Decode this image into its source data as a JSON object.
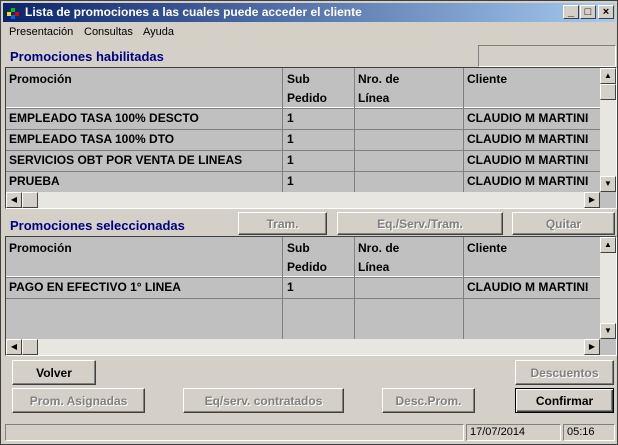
{
  "window": {
    "title": "Lista de promociones a las cuales puede acceder el cliente",
    "controls": {
      "minimize": "_",
      "maximize": "□",
      "close": "×"
    }
  },
  "menu": [
    "Presentación",
    "Consultas",
    "Ayuda"
  ],
  "habilitadas": {
    "label": "Promociones habilitadas",
    "headers": [
      "Promoción",
      "Sub\nPedido",
      "Nro. de\nLínea",
      "Cliente"
    ],
    "rows": [
      [
        "EMPLEADO TASA 100% DESCTO",
        "1",
        "",
        "CLAUDIO M MARTINI"
      ],
      [
        "EMPLEADO TASA 100% DTO",
        "1",
        "",
        "CLAUDIO M MARTINI"
      ],
      [
        "SERVICIOS OBT POR VENTA DE LINEAS",
        "1",
        "",
        "CLAUDIO M MARTINI"
      ],
      [
        "PRUEBA",
        "1",
        "",
        "CLAUDIO M MARTINI"
      ]
    ]
  },
  "seleccionadas": {
    "label": "Promociones seleccionadas",
    "headers": [
      "Promoción",
      "Sub\nPedido",
      "Nro. de\nLínea",
      "Cliente"
    ],
    "rows": [
      [
        "PAGO EN EFECTIVO 1° LINEA",
        "1",
        "",
        "CLAUDIO M MARTINI"
      ]
    ],
    "buttons": {
      "tram": "Tram.",
      "eq_serv_tram": "Eq./Serv./Tram.",
      "quitar": "Quitar"
    }
  },
  "buttons": {
    "volver": "Volver",
    "descuentos": "Descuentos",
    "prom_asignadas": "Prom. Asignadas",
    "eq_serv_contratados": "Eq/serv. contratados",
    "desc_prom": "Desc.Prom.",
    "confirmar": "Confirmar"
  },
  "status": {
    "message": "",
    "date": "17/07/2014",
    "time": "05:16"
  },
  "scroll_arrows": {
    "up": "▲",
    "down": "▼",
    "left": "◀",
    "right": "▶"
  },
  "colors": {
    "title_gradient_start": "#0a246a",
    "title_gradient_end": "#a6caf0",
    "face": "#d4d0c8",
    "section_label": "#000080"
  }
}
